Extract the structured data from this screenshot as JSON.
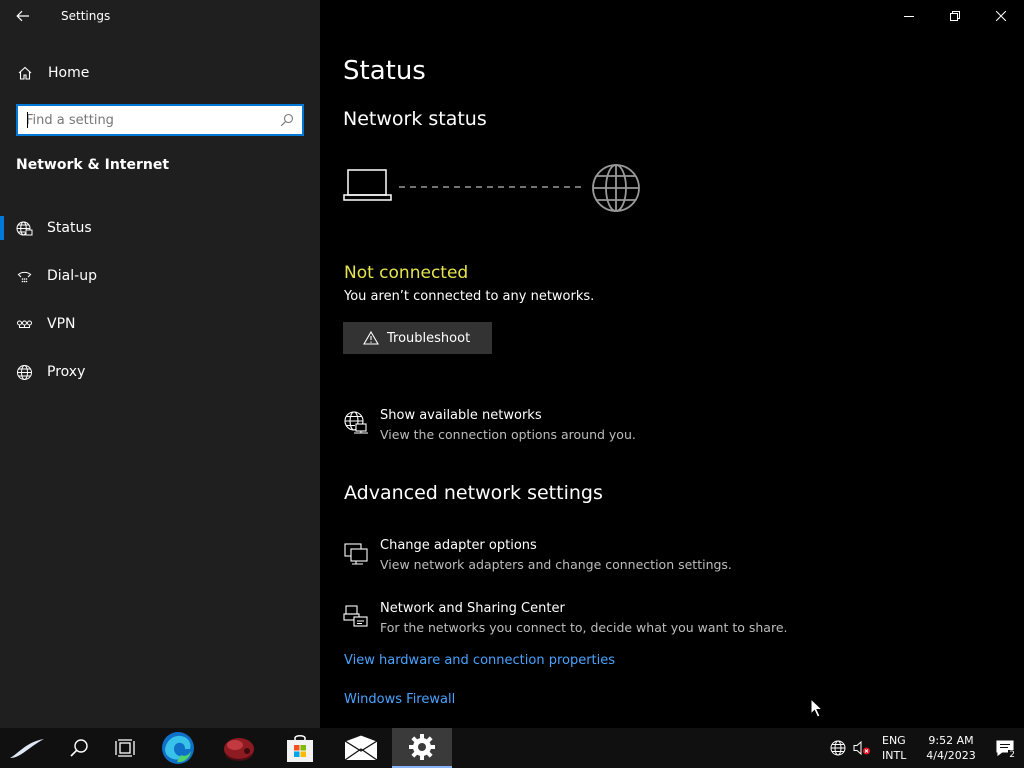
{
  "window": {
    "title": "Settings"
  },
  "sidebar": {
    "home_label": "Home",
    "search_placeholder": "Find a setting",
    "section_title": "Network & Internet",
    "items": [
      {
        "label": "Status",
        "icon": "globe-network-icon",
        "selected": true
      },
      {
        "label": "Dial-up",
        "icon": "dialup-icon",
        "selected": false
      },
      {
        "label": "VPN",
        "icon": "vpn-icon",
        "selected": false
      },
      {
        "label": "Proxy",
        "icon": "globe-icon",
        "selected": false
      }
    ]
  },
  "main": {
    "title": "Status",
    "network_status_title": "Network status",
    "connection_state": "Not connected",
    "connection_desc": "You aren’t connected to any networks.",
    "troubleshoot_label": "Troubleshoot",
    "show_networks": {
      "title": "Show available networks",
      "desc": "View the connection options around you."
    },
    "advanced_title": "Advanced network settings",
    "adapter": {
      "title": "Change adapter options",
      "desc": "View network adapters and change connection settings."
    },
    "sharing": {
      "title": "Network and Sharing Center",
      "desc": "For the networks you connect to, decide what you want to share."
    },
    "hardware_link": "View hardware and connection properties",
    "firewall_link": "Windows Firewall"
  },
  "taskbar": {
    "lang_line1": "ENG",
    "lang_line2": "INTL",
    "time": "9:52 AM",
    "date": "4/4/2023",
    "notification_count": "2"
  },
  "colors": {
    "accent": "#0078d7",
    "warning_text": "#e6e44f",
    "link": "#4aa3ff",
    "sidebar_bg": "#1f1f1f",
    "main_bg": "#000000"
  }
}
